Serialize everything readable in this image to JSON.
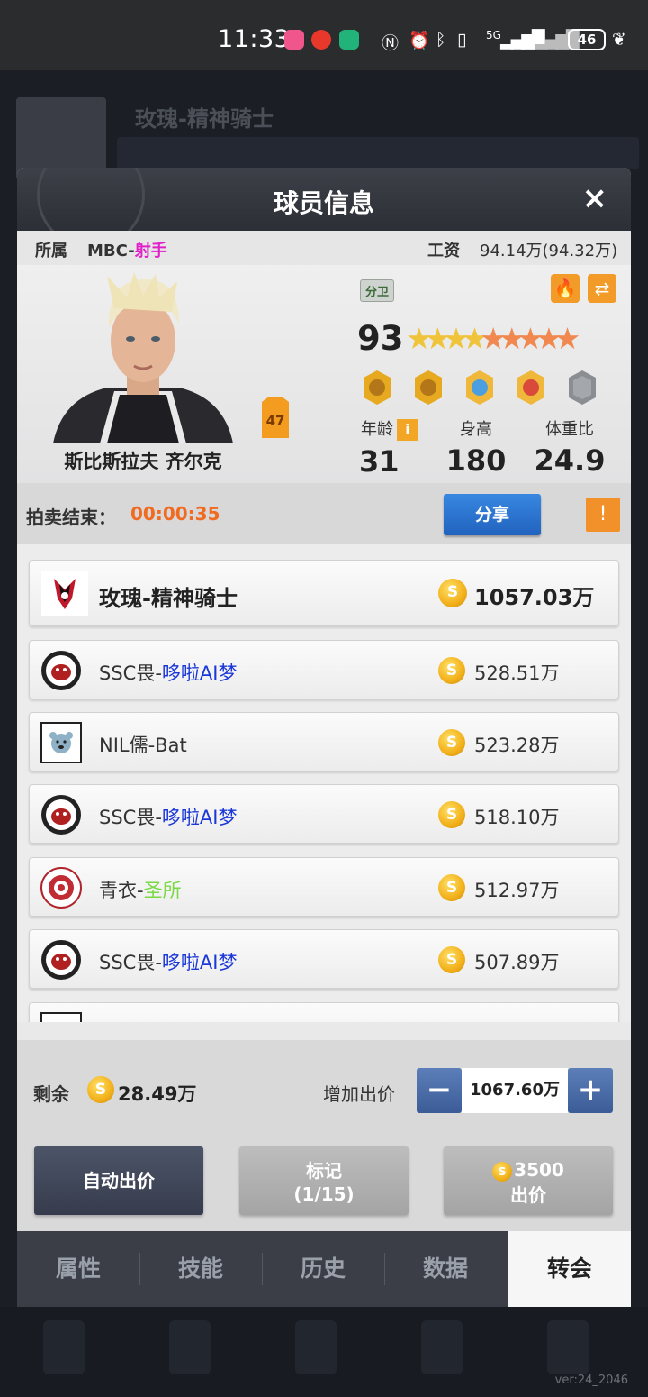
{
  "status_bar": {
    "time": "11:33",
    "battery": "46",
    "signal_text": "5G"
  },
  "background": {
    "team_title": "玫瑰-精神骑士"
  },
  "dialog": {
    "title": "球员信息",
    "affiliation_label": "所属",
    "affiliation_value": "MBC-",
    "affiliation_role": "射手",
    "salary_label": "工资",
    "salary_value": "94.14万(94.32万)",
    "player": {
      "name": "斯比斯拉夫 齐尔克",
      "position": "分卫",
      "rating": "93",
      "stars_gold": 4,
      "stars_orange": 5,
      "jersey_number": "47",
      "age_label": "年龄",
      "age": "31",
      "height_label": "身高",
      "height": "180",
      "bmi_label": "体重比",
      "bmi": "24.9",
      "info_icon": "i"
    },
    "auction": {
      "label": "拍卖结束：",
      "timer": "00:00:35",
      "share_label": "分享",
      "warn_icon": "!"
    },
    "bids": [
      {
        "team": "玫瑰-精神骑士",
        "club": "",
        "club_color": "",
        "amount": "1057.03万",
        "logo": "rose-logo"
      },
      {
        "team": "SSC畏-",
        "club": "哆啦AI梦",
        "club_color": "blue",
        "amount": "528.51万",
        "logo": "boar-logo"
      },
      {
        "team": "NIL儒-Bat",
        "club": "",
        "club_color": "",
        "amount": "523.28万",
        "logo": "bear-logo"
      },
      {
        "team": "SSC畏-",
        "club": "哆啦AI梦",
        "club_color": "blue",
        "amount": "518.10万",
        "logo": "boar-logo"
      },
      {
        "team": "青衣-",
        "club": "圣所",
        "club_color": "green",
        "amount": "512.97万",
        "logo": "circle-logo"
      },
      {
        "team": "SSC畏-",
        "club": "哆啦AI梦",
        "club_color": "blue",
        "amount": "507.89万",
        "logo": "boar-logo"
      }
    ],
    "remaining_label": "剩余",
    "remaining_value": "28.49万",
    "add_bid_label": "增加出价",
    "bid_input_value": "1067.60万",
    "minus_label": "−",
    "plus_label": "+",
    "auto_bid_label": "自动出价",
    "mark_label": "标记",
    "mark_count": "(1/15)",
    "bid_cost": "3500",
    "bid_label": "出价",
    "coin_symbol": "S",
    "close_icon": "×",
    "tabs": [
      "属性",
      "技能",
      "历史",
      "数据",
      "转会"
    ],
    "active_tab": "转会"
  },
  "version": "ver:24_2046",
  "colors": {
    "accent_orange": "#f06a1f",
    "club_blue": "#1a37d8",
    "club_green": "#7ad944",
    "role_magenta": "#e020c8",
    "share_blue": "#2a73d0"
  }
}
